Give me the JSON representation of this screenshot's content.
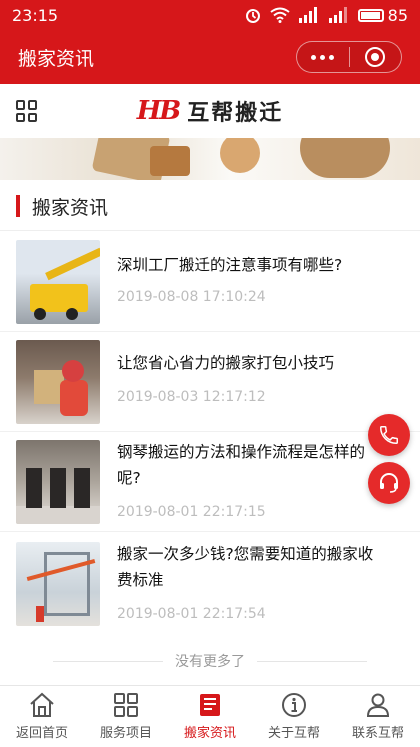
{
  "status_bar": {
    "time": "23:15",
    "battery": "85"
  },
  "nav_bar": {
    "title": "搬家资讯"
  },
  "header": {
    "logo_mark": "HB",
    "logo_text": "互帮搬迁"
  },
  "section": {
    "title": "搬家资讯"
  },
  "news": [
    {
      "title": "深圳工厂搬迁的注意事项有哪些?",
      "date": "2019-08-08 17:10:24"
    },
    {
      "title": "让您省心省力的搬家打包小技巧",
      "date": "2019-08-03 12:17:12"
    },
    {
      "title": "钢琴搬运的方法和操作流程是怎样的呢?",
      "date": "2019-08-01 22:17:15"
    },
    {
      "title": "搬家一次多少钱?您需要知道的搬家收费标准",
      "date": "2019-08-01 22:17:54"
    }
  ],
  "no_more_text": "没有更多了",
  "tabs": [
    {
      "label": "返回首页",
      "icon": "home-icon"
    },
    {
      "label": "服务项目",
      "icon": "grid-icon"
    },
    {
      "label": "搬家资讯",
      "icon": "news-icon",
      "active": true
    },
    {
      "label": "关于互帮",
      "icon": "info-icon"
    },
    {
      "label": "联系互帮",
      "icon": "user-icon"
    }
  ],
  "colors": {
    "brand": "#d6171a",
    "fab": "#e52a2a",
    "active_tab": "#d6171a"
  }
}
